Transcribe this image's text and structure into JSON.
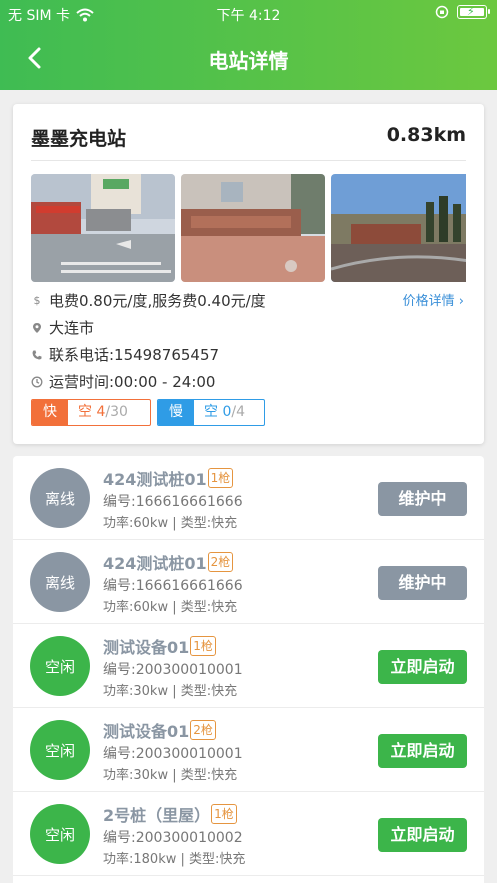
{
  "status_bar": {
    "carrier": "无 SIM 卡",
    "time": "下午 4:12"
  },
  "nav": {
    "title": "电站详情"
  },
  "station": {
    "name": "墨墨充电站",
    "distance": "0.83km",
    "price": "电费0.80元/度,服务费0.40元/度",
    "price_link": "价格详情",
    "city": "大连市",
    "phone": "联系电话:15498765457",
    "hours": "运营时间:00:00 - 24:00",
    "fast": {
      "label": "快",
      "free_text": "空",
      "free": "4",
      "total": "/30"
    },
    "slow": {
      "label": "慢",
      "free_text": "空",
      "free": "0",
      "total": "/4"
    }
  },
  "piles": [
    {
      "status": "离线",
      "name": "424测试桩01",
      "badge": "1枪",
      "number": "编号:166616661666",
      "meta": "功率:60kw | 类型:快充",
      "button": "维护中",
      "kind": "offline"
    },
    {
      "status": "离线",
      "name": "424测试桩01",
      "badge": "2枪",
      "number": "编号:166616661666",
      "meta": "功率:60kw | 类型:快充",
      "button": "维护中",
      "kind": "offline"
    },
    {
      "status": "空闲",
      "name": "测试设备01",
      "badge": "1枪",
      "number": "编号:200300010001",
      "meta": "功率:30kw | 类型:快充",
      "button": "立即启动",
      "kind": "idle"
    },
    {
      "status": "空闲",
      "name": "测试设备01",
      "badge": "2枪",
      "number": "编号:200300010001",
      "meta": "功率:30kw | 类型:快充",
      "button": "立即启动",
      "kind": "idle"
    },
    {
      "status": "空闲",
      "name": "2号桩（里屋）",
      "badge": "1枪",
      "number": "编号:200300010002",
      "meta": "功率:180kw | 类型:快充",
      "button": "立即启动",
      "kind": "idle"
    }
  ],
  "colors": {
    "offline": "#8a96a3",
    "idle": "#3cb54a",
    "offline_button": "#8a96a3",
    "idle_button": "#3cb54a"
  }
}
